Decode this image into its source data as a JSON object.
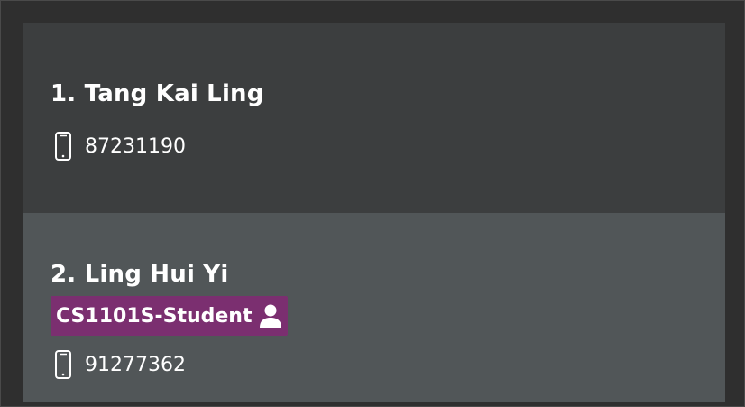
{
  "contacts": [
    {
      "index_name": "1. Tang Kai Ling",
      "tags": [],
      "phone": "87231190"
    },
    {
      "index_name": "2. Ling Hui Yi",
      "tags": [
        {
          "label": "CS1101S-Student",
          "icon": "person-icon",
          "color": "#7b2f70"
        }
      ],
      "phone": "91277362"
    }
  ],
  "icons": {
    "phone": "mobile-phone-icon",
    "tag": "person-icon"
  },
  "colors": {
    "card_default": "#3c3e3f",
    "card_selected": "#515658",
    "tag_background": "#7b2f70",
    "text": "#ffffff"
  }
}
